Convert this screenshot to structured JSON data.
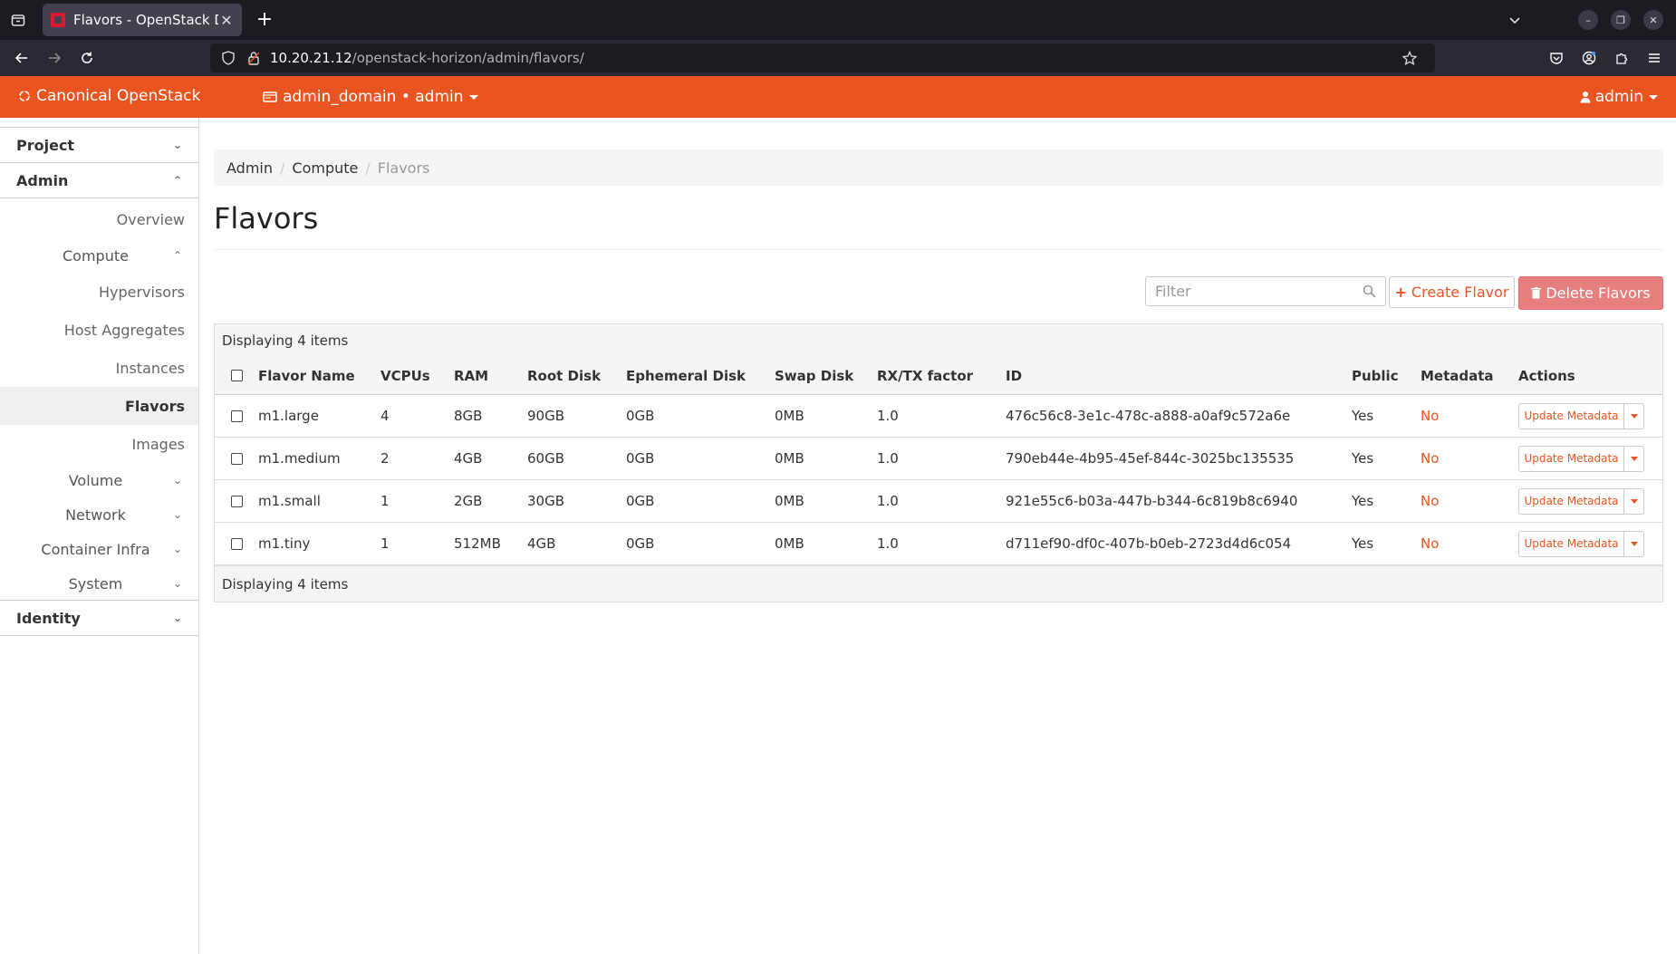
{
  "browser": {
    "tab_title": "Flavors - OpenStack Dash",
    "url_host": "10.20.21.12",
    "url_path": "/openstack-horizon/admin/flavors/"
  },
  "header": {
    "brand": "Canonical OpenStack",
    "domain_project": "admin_domain • admin",
    "user": "admin",
    "accent": "#e95420"
  },
  "sidebar": {
    "project": "Project",
    "admin": "Admin",
    "overview": "Overview",
    "compute": "Compute",
    "hypervisors": "Hypervisors",
    "host_aggregates": "Host Aggregates",
    "instances": "Instances",
    "flavors": "Flavors",
    "images": "Images",
    "volume": "Volume",
    "network": "Network",
    "container_infra": "Container Infra",
    "system": "System",
    "identity": "Identity"
  },
  "breadcrumb": [
    "Admin",
    "Compute",
    "Flavors"
  ],
  "page_title": "Flavors",
  "toolbar": {
    "filter_placeholder": "Filter",
    "create_label": "Create Flavor",
    "delete_label": "Delete Flavors"
  },
  "table": {
    "caption": "Displaying 4 items",
    "footer": "Displaying 4 items",
    "headers": [
      "Flavor Name",
      "VCPUs",
      "RAM",
      "Root Disk",
      "Ephemeral Disk",
      "Swap Disk",
      "RX/TX factor",
      "ID",
      "Public",
      "Metadata",
      "Actions"
    ],
    "rows": [
      {
        "name": "m1.large",
        "vcpus": "4",
        "ram": "8GB",
        "root": "90GB",
        "eph": "0GB",
        "swap": "0MB",
        "rxtx": "1.0",
        "id": "476c56c8-3e1c-478c-a888-a0af9c572a6e",
        "public": "Yes",
        "metadata": "No",
        "action": "Update Metadata"
      },
      {
        "name": "m1.medium",
        "vcpus": "2",
        "ram": "4GB",
        "root": "60GB",
        "eph": "0GB",
        "swap": "0MB",
        "rxtx": "1.0",
        "id": "790eb44e-4b95-45ef-844c-3025bc135535",
        "public": "Yes",
        "metadata": "No",
        "action": "Update Metadata"
      },
      {
        "name": "m1.small",
        "vcpus": "1",
        "ram": "2GB",
        "root": "30GB",
        "eph": "0GB",
        "swap": "0MB",
        "rxtx": "1.0",
        "id": "921e55c6-b03a-447b-b344-6c819b8c6940",
        "public": "Yes",
        "metadata": "No",
        "action": "Update Metadata"
      },
      {
        "name": "m1.tiny",
        "vcpus": "1",
        "ram": "512MB",
        "root": "4GB",
        "eph": "0GB",
        "swap": "0MB",
        "rxtx": "1.0",
        "id": "d711ef90-df0c-407b-b0eb-2723d4d6c054",
        "public": "Yes",
        "metadata": "No",
        "action": "Update Metadata"
      }
    ]
  }
}
